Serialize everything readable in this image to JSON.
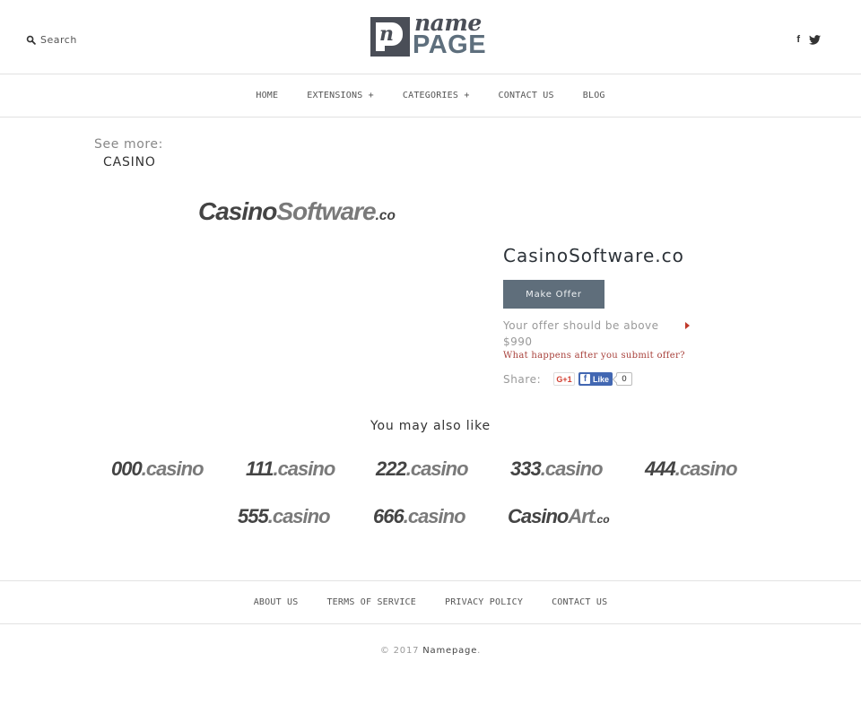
{
  "header": {
    "search_label": "Search",
    "logo": {
      "top_word": "name",
      "bottom_word": "PAGE",
      "monogram": "n"
    },
    "social": {
      "facebook": "f"
    }
  },
  "nav": {
    "items": [
      {
        "label": "HOME"
      },
      {
        "label": "EXTENSIONS +"
      },
      {
        "label": "CATEGORIES +"
      },
      {
        "label": "CONTACT US"
      },
      {
        "label": "BLOG"
      }
    ]
  },
  "see_more": {
    "label": "See more:",
    "category": "CASINO"
  },
  "product": {
    "logo": {
      "part1": "Casino",
      "part2": "Software",
      "tld": ".co"
    },
    "title": "CasinoSoftware.co",
    "make_offer_label": "Make Offer",
    "offer_note": "Your offer should be above",
    "offer_min": "$990",
    "what_happens_label": "What happens after you submit offer?",
    "share_label": "Share:",
    "gplus_label": "G+1",
    "fb_like_label": "Like",
    "fb_like_count": "0"
  },
  "related": {
    "heading": "You may also like",
    "items": [
      {
        "part1": "000",
        "part2": ".casino",
        "tld": ""
      },
      {
        "part1": "111",
        "part2": ".casino",
        "tld": ""
      },
      {
        "part1": "222",
        "part2": ".casino",
        "tld": ""
      },
      {
        "part1": "333",
        "part2": ".casino",
        "tld": ""
      },
      {
        "part1": "444",
        "part2": ".casino",
        "tld": ""
      },
      {
        "part1": "555",
        "part2": ".casino",
        "tld": ""
      },
      {
        "part1": "666",
        "part2": ".casino",
        "tld": ""
      },
      {
        "part1": "Casino",
        "part2": "Art",
        "tld": ".co"
      }
    ]
  },
  "footer": {
    "links": [
      {
        "label": "ABOUT US"
      },
      {
        "label": "TERMS OF SERVICE"
      },
      {
        "label": "PRIVACY POLICY"
      },
      {
        "label": "CONTACT US"
      }
    ],
    "copyright_prefix": "© 2017",
    "brand": "Namepage",
    "suffix": "."
  },
  "colors": {
    "button_bg": "#5f6e7b",
    "link_red": "#a8413b",
    "logo_dark": "#4a4e57",
    "logo_slate": "#5e6f7d"
  }
}
